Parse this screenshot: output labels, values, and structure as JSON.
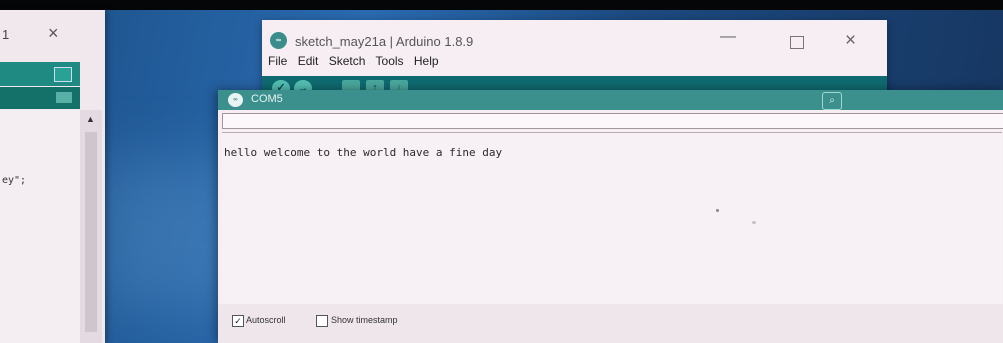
{
  "background_window": {
    "title_fragment": "1",
    "close_glyph": "×",
    "code_fragment": "ey\";"
  },
  "sketch_window": {
    "title": "sketch_may21a | Arduino 1.8.9",
    "logo_text": "∞",
    "menu": [
      "File",
      "Edit",
      "Sketch",
      "Tools",
      "Help"
    ],
    "controls": {
      "minimize": "—",
      "close": "×"
    },
    "toolbar_icons": [
      "verify-icon",
      "upload-icon",
      "new-icon",
      "open-icon",
      "save-icon"
    ]
  },
  "serial_monitor": {
    "title": "COM5",
    "logo_text": "∞",
    "output_lines": [
      "hello welcome to the world have a fine day"
    ],
    "autoscroll_label": "Autoscroll",
    "autoscroll_checked": true,
    "timestamp_label": "Show timestamp",
    "timestamp_checked": false,
    "check_glyph": "✓"
  },
  "colors": {
    "arduino_teal": "#0f6b70",
    "serial_titlebar": "#3b8f8d",
    "desktop_blue": "#1d3f6e"
  }
}
